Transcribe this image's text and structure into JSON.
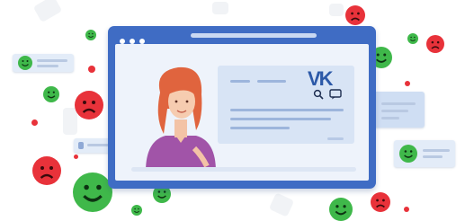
{
  "illustration": {
    "logo": "VK",
    "colors": {
      "window": "#3f6cc4",
      "window_content": "#eef3fb",
      "card": "#d8e4f5",
      "bubble": "#e3ecf8",
      "happy": "#3fb84a",
      "sad": "#e8323a",
      "hair": "#e0643e",
      "shirt": "#a154a8"
    },
    "icons": [
      "search-icon",
      "chat-icon",
      "happy-face-icon",
      "sad-face-icon"
    ]
  }
}
